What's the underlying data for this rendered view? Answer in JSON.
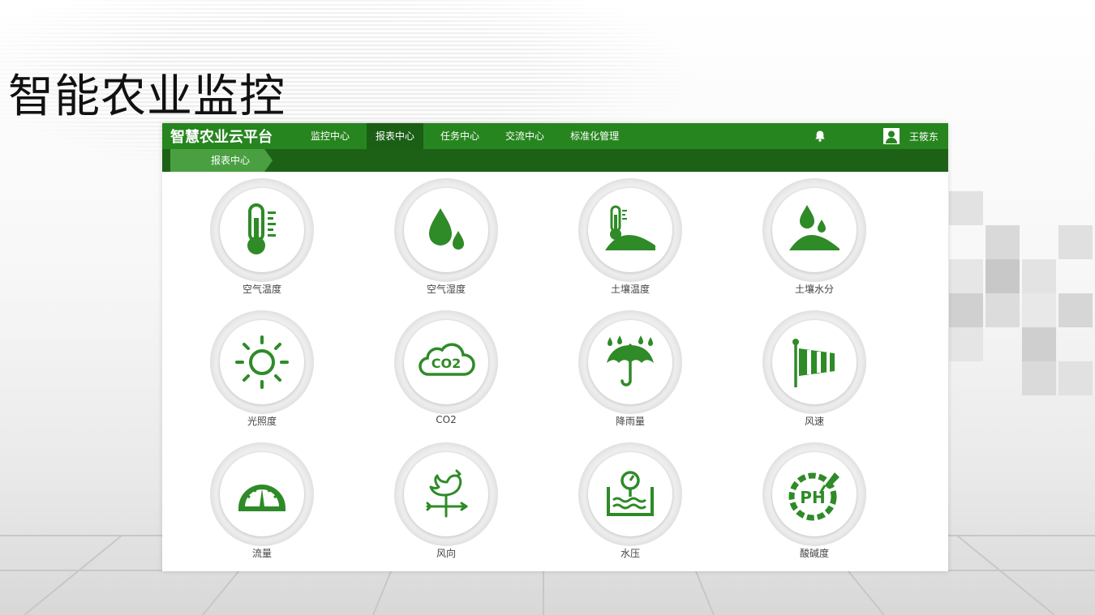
{
  "slide": {
    "title": "智能农业监控"
  },
  "app": {
    "brand": "智慧农业云平台",
    "nav": [
      {
        "label": "监控中心",
        "active": false
      },
      {
        "label": "报表中心",
        "active": true
      },
      {
        "label": "任务中心",
        "active": false
      },
      {
        "label": "交流中心",
        "active": false
      },
      {
        "label": "标准化管理",
        "active": false
      }
    ],
    "user": {
      "name": "王筱东",
      "icon": "user-icon",
      "notification_icon": "bell-icon"
    },
    "breadcrumb": "报表中心"
  },
  "report_tiles": [
    {
      "label": "空气温度",
      "icon": "thermometer-icon"
    },
    {
      "label": "空气湿度",
      "icon": "water-drops-icon"
    },
    {
      "label": "土壤温度",
      "icon": "soil-thermometer-icon"
    },
    {
      "label": "土壤水分",
      "icon": "soil-moisture-icon"
    },
    {
      "label": "光照度",
      "icon": "sun-icon"
    },
    {
      "label": "CO2",
      "icon": "co2-cloud-icon"
    },
    {
      "label": "降雨量",
      "icon": "umbrella-rain-icon"
    },
    {
      "label": "风速",
      "icon": "windsock-icon"
    },
    {
      "label": "流量",
      "icon": "gauge-icon"
    },
    {
      "label": "风向",
      "icon": "weathervane-icon"
    },
    {
      "label": "水压",
      "icon": "water-pressure-icon"
    },
    {
      "label": "酸碱度",
      "icon": "ph-icon"
    }
  ],
  "colors": {
    "primary_green": "#27851f",
    "dark_green": "#1d6117",
    "active_tab": "#1b5e15",
    "crumb_green": "#4aa041",
    "icon_green": "#2e8b27"
  }
}
